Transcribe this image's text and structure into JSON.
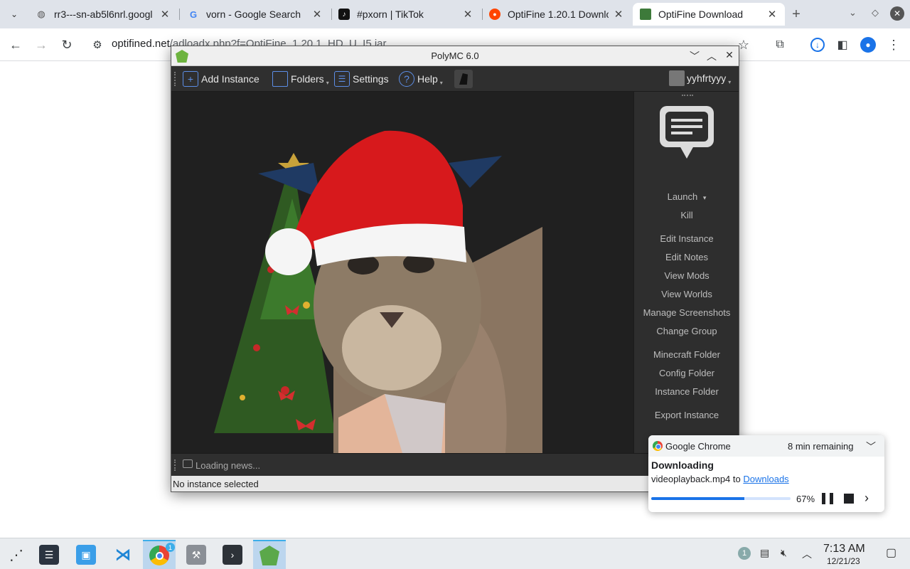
{
  "browser": {
    "tabs": [
      {
        "title": "rr3---sn-ab5l6nrl.googl",
        "favicon": "globe-icon"
      },
      {
        "title": "vorn - Google Search",
        "favicon": "google-icon"
      },
      {
        "title": "#pxorn | TikTok",
        "favicon": "tiktok-icon"
      },
      {
        "title": "OptiFine 1.20.1 Downlo",
        "favicon": "reddit-icon"
      },
      {
        "title": "OptiFine Download",
        "favicon": "optifine-icon"
      }
    ],
    "url_domain": "optifined.net",
    "url_path": "/adloadx.php?f=OptiFine_1.20.1_HD_U_I5.jar"
  },
  "polymc": {
    "title": "PolyMC 6.0",
    "toolbar": {
      "add_instance": "Add Instance",
      "folders": "Folders",
      "settings": "Settings",
      "help": "Help",
      "account": "yyhfrtyyy"
    },
    "sidebar": {
      "launch": "Launch",
      "kill": "Kill",
      "edit_instance": "Edit Instance",
      "edit_notes": "Edit Notes",
      "view_mods": "View Mods",
      "view_worlds": "View Worlds",
      "manage_screenshots": "Manage Screenshots",
      "change_group": "Change Group",
      "minecraft_folder": "Minecraft Folder",
      "config_folder": "Config Folder",
      "instance_folder": "Instance Folder",
      "export_instance": "Export Instance"
    },
    "news": "Loading news...",
    "status": "No instance selected"
  },
  "download": {
    "app": "Google Chrome",
    "remaining": "8 min remaining",
    "state": "Downloading",
    "file_prefix": "videoplayback.mp4 to ",
    "file_link": "Downloads",
    "percent_label": "67%",
    "progress": 0.67
  },
  "taskbar": {
    "time": "7:13 AM",
    "date": "12/21/23",
    "notification_count": "1",
    "chrome_badge": "1"
  },
  "colors": {
    "chrome_tabstrip": "#dfe3ea",
    "polymc_dark": "#2a2a2a",
    "accent_blue": "#1a73e8",
    "taskbar": "#e9ecef"
  }
}
